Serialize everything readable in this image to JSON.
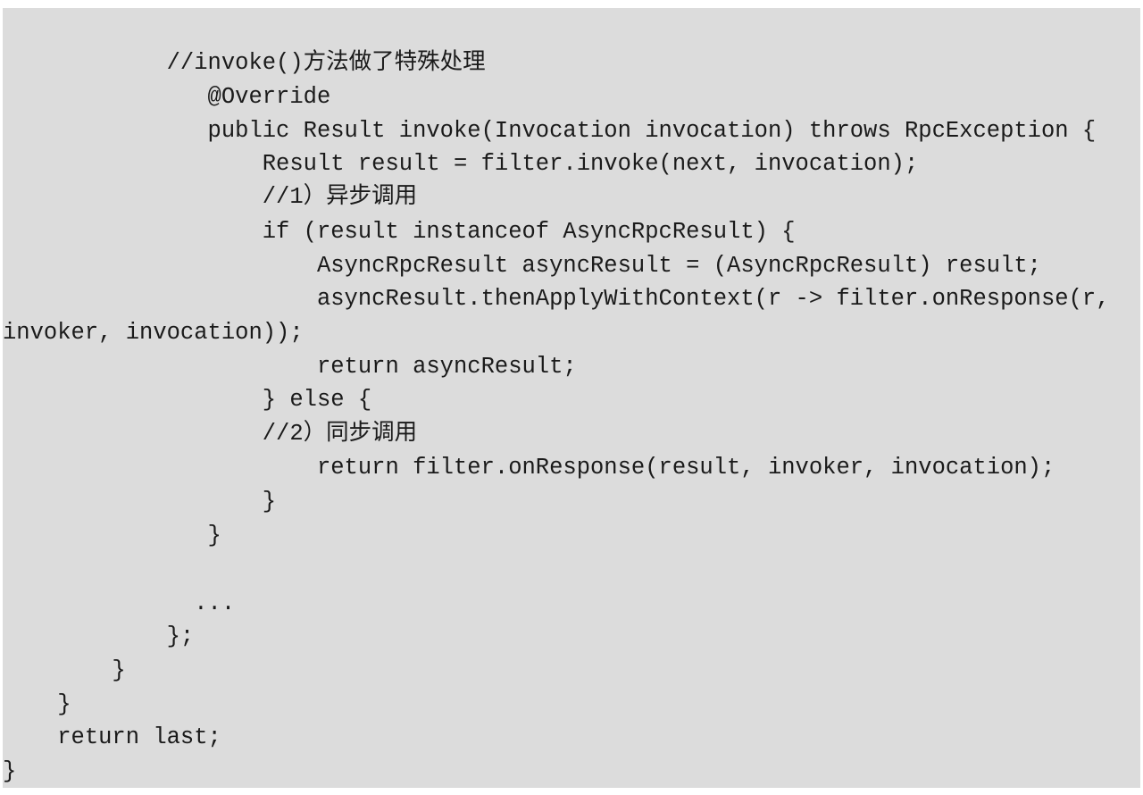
{
  "code": {
    "lines": [
      "            //invoke()方法做了特殊处理",
      "               @Override",
      "               public Result invoke(Invocation invocation) throws RpcException {",
      "                   Result result = filter.invoke(next, invocation);",
      "                   //1）异步调用",
      "                   if (result instanceof AsyncRpcResult) {",
      "                       AsyncRpcResult asyncResult = (AsyncRpcResult) result;",
      "                       asyncResult.thenApplyWithContext(r -> filter.onResponse(r,",
      "invoker, invocation));",
      "                       return asyncResult;",
      "                   } else {",
      "                   //2）同步调用",
      "                       return filter.onResponse(result, invoker, invocation);",
      "                   }",
      "               }",
      "",
      "              ...",
      "            };",
      "        }",
      "    }",
      "    return last;",
      "}"
    ]
  }
}
